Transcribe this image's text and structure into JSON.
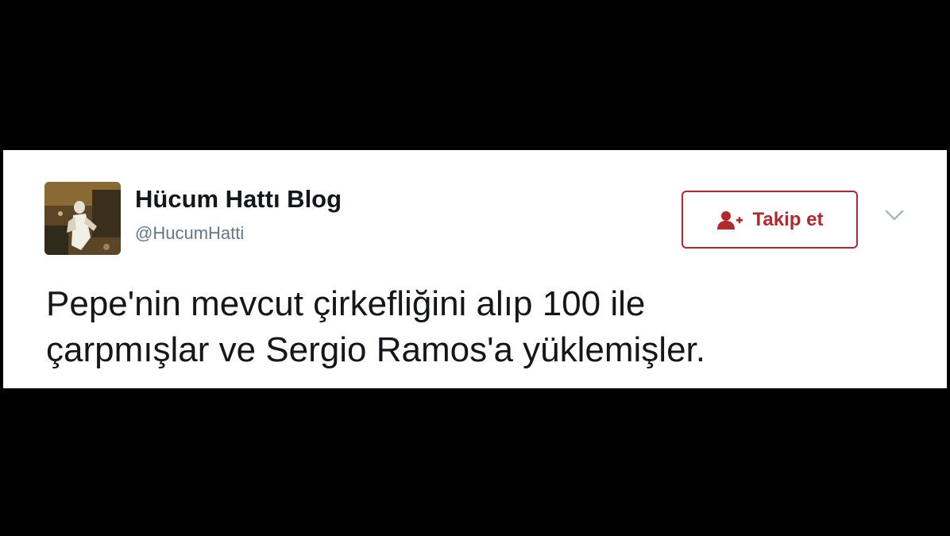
{
  "tweet": {
    "author": {
      "display_name": "Hücum Hattı Blog",
      "handle": "@HucumHatti",
      "avatar_icon": "user-avatar-photo"
    },
    "follow_button": {
      "label": "Takip et",
      "icon": "add-user-icon",
      "color": "#b3282d"
    },
    "menu_icon": "chevron-down-icon",
    "text_lines": [
      "Pepe'nin mevcut çirkefliğini alıp 100 ile",
      "çarpmışlar ve Sergio Ramos'a yüklemişler."
    ]
  },
  "colors": {
    "background": "#000000",
    "card": "#ffffff",
    "text_primary": "#14171a",
    "text_secondary": "#657786",
    "accent": "#b3282d"
  }
}
